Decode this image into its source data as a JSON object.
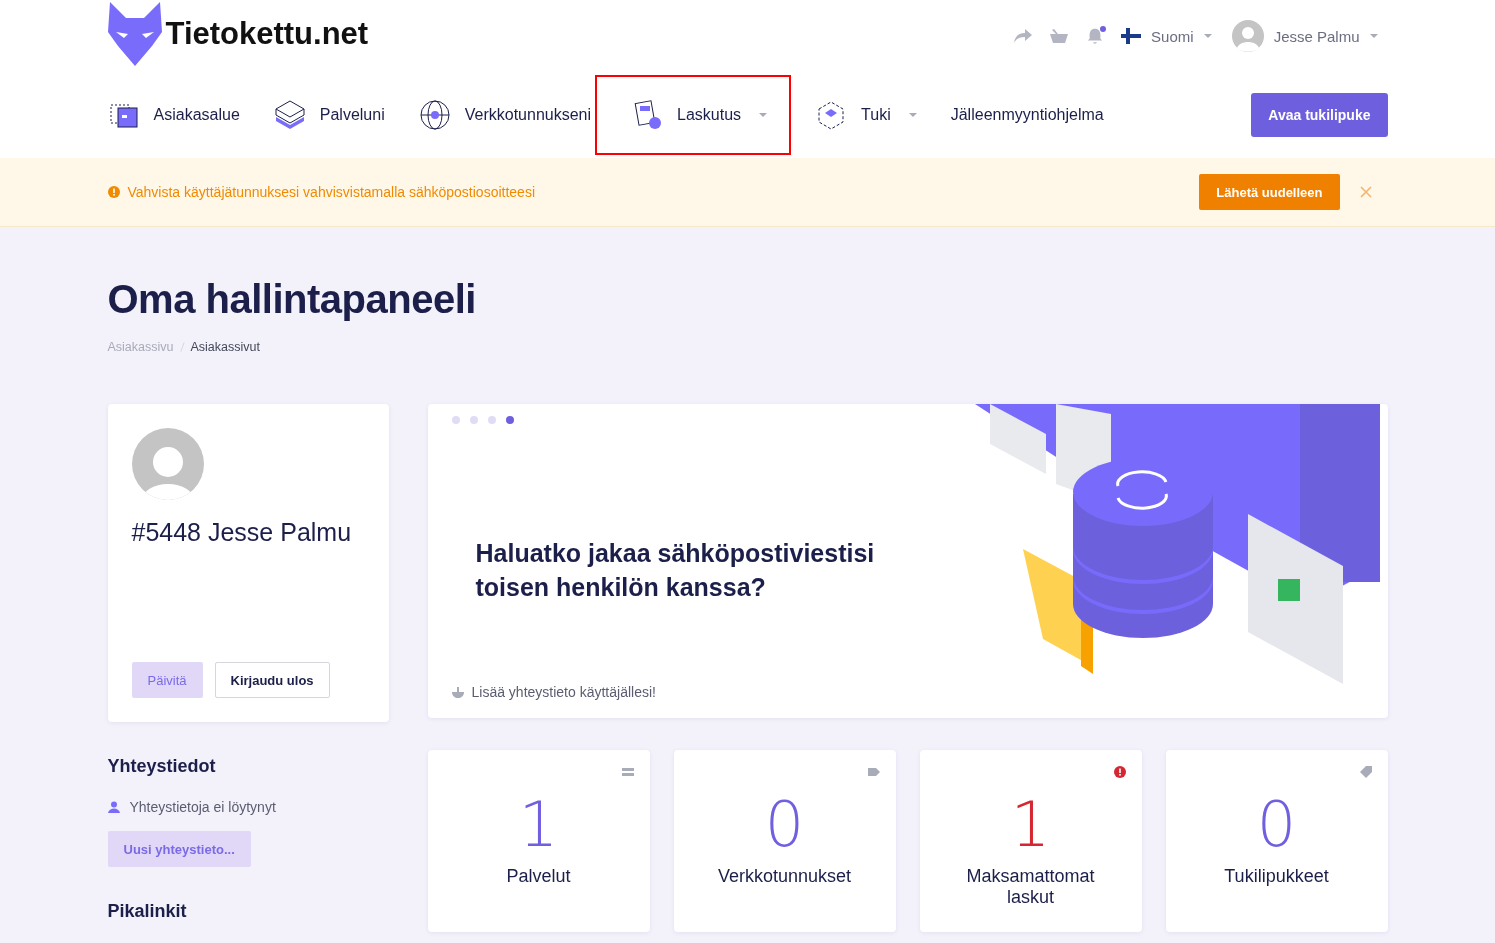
{
  "logo": {
    "text": "Tietokettu.net"
  },
  "topbar": {
    "language": "Suomi",
    "user": "Jesse Palmu",
    "notification_dot": true
  },
  "nav": [
    {
      "kind": "area",
      "label": "Asiakasalue",
      "dropdown": false,
      "highlighted": false
    },
    {
      "kind": "server",
      "label": "Palveluni",
      "dropdown": false,
      "highlighted": false
    },
    {
      "kind": "globe",
      "label": "Verkkotunnukseni",
      "dropdown": false,
      "highlighted": false
    },
    {
      "kind": "invoice",
      "label": "Laskutus",
      "dropdown": true,
      "highlighted": true
    },
    {
      "kind": "support",
      "label": "Tuki",
      "dropdown": true,
      "highlighted": false
    },
    {
      "kind": "none",
      "label": "Jälleenmyyntiohjelma",
      "dropdown": false,
      "highlighted": false
    }
  ],
  "nav_button": "Avaa tukilipuke",
  "alert": {
    "message": "Vahvista käyttäjätunnuksesi vahvisvistamalla sähköpostiosoitteesi",
    "button": "Lähetä uudelleen"
  },
  "page_title": "Oma hallintapaneeli",
  "breadcrumb": [
    {
      "label": "Asiakassivu",
      "selected": false
    },
    {
      "label": "Asiakassivut",
      "selected": true
    }
  ],
  "profile": {
    "name": "#5448 Jesse Palmu",
    "buttons": [
      "Päivitä",
      "Kirjaudu ulos"
    ]
  },
  "promo": {
    "dots": [
      {
        "selected": false
      },
      {
        "selected": false
      },
      {
        "selected": false
      },
      {
        "selected": true
      }
    ],
    "heading": "Haluatko jakaa sähköpostiviestisi toisen henkilön kanssa?",
    "footer": "Lisää yhteystieto käyttäjällesi!"
  },
  "contacts": {
    "title": "Yhteystiedot",
    "empty": "Yhteystietoja ei löytynyt",
    "button": "Uusi yhteystieto..."
  },
  "quicklinks": {
    "title": "Pikalinkit"
  },
  "stats": [
    {
      "kind": "services",
      "value": "1",
      "label": "Palvelut",
      "color": "#7060e0"
    },
    {
      "kind": "domains",
      "value": "0",
      "label": "Verkkotunnukset",
      "color": "#7060e0"
    },
    {
      "kind": "alert",
      "value": "1",
      "label": "Maksamattomat laskut",
      "color": "#d62631"
    },
    {
      "kind": "tickets",
      "value": "0",
      "label": "Tukilipukkeet",
      "color": "#7060e0"
    }
  ]
}
